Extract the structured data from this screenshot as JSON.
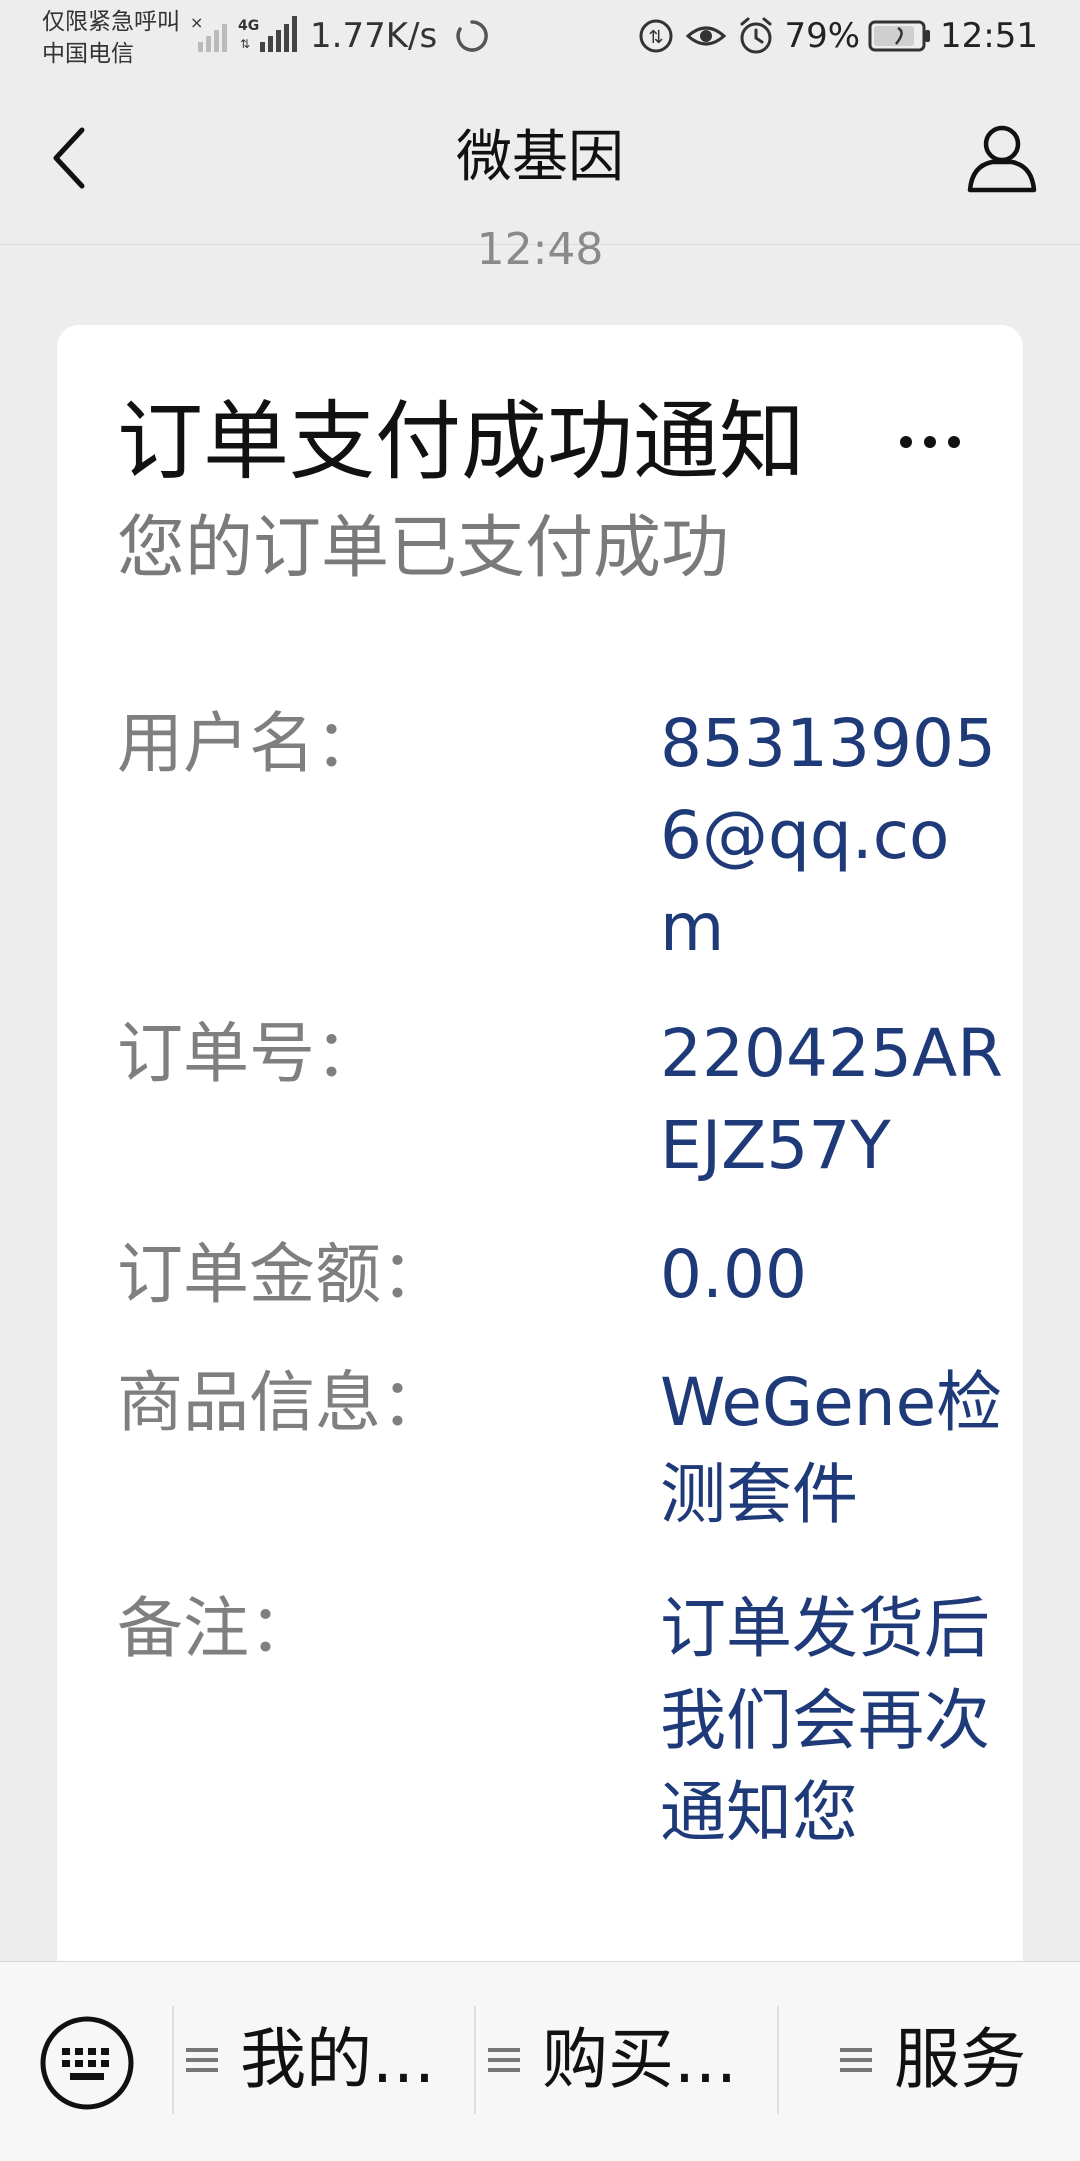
{
  "status_bar": {
    "carrier_line1": "仅限紧急呼叫",
    "carrier_line2": "中国电信",
    "net_speed": "1.77K/s",
    "battery": "79%",
    "time": "12:51"
  },
  "nav": {
    "title": "微基因"
  },
  "timestamp": "12:48",
  "card": {
    "title": "订单支付成功通知",
    "subtitle": "您的订单已支付成功",
    "rows": [
      {
        "label": "用户名：",
        "value": "853139056@qq.com"
      },
      {
        "label": "订单号：",
        "value": "220425AREJZ57Y"
      },
      {
        "label": "订单金额：",
        "value": "0.00"
      },
      {
        "label": "商品信息：",
        "value": "WeGene检测套件"
      },
      {
        "label": "备注：",
        "value": "订单发货后我们会再次通知您"
      }
    ]
  },
  "bottom_menu": {
    "items": [
      {
        "label": "我的..."
      },
      {
        "label": "购买..."
      },
      {
        "label": "服务"
      }
    ]
  },
  "icons": {
    "back": "chevron-left-icon",
    "profile": "person-icon",
    "more": "more-dots-icon",
    "keyboard": "keyboard-icon",
    "menu": "hamburger-icon"
  },
  "colors": {
    "background": "#ededed",
    "card": "#ffffff",
    "value_text": "#1f3a78",
    "label_text": "#7f7f7f"
  }
}
